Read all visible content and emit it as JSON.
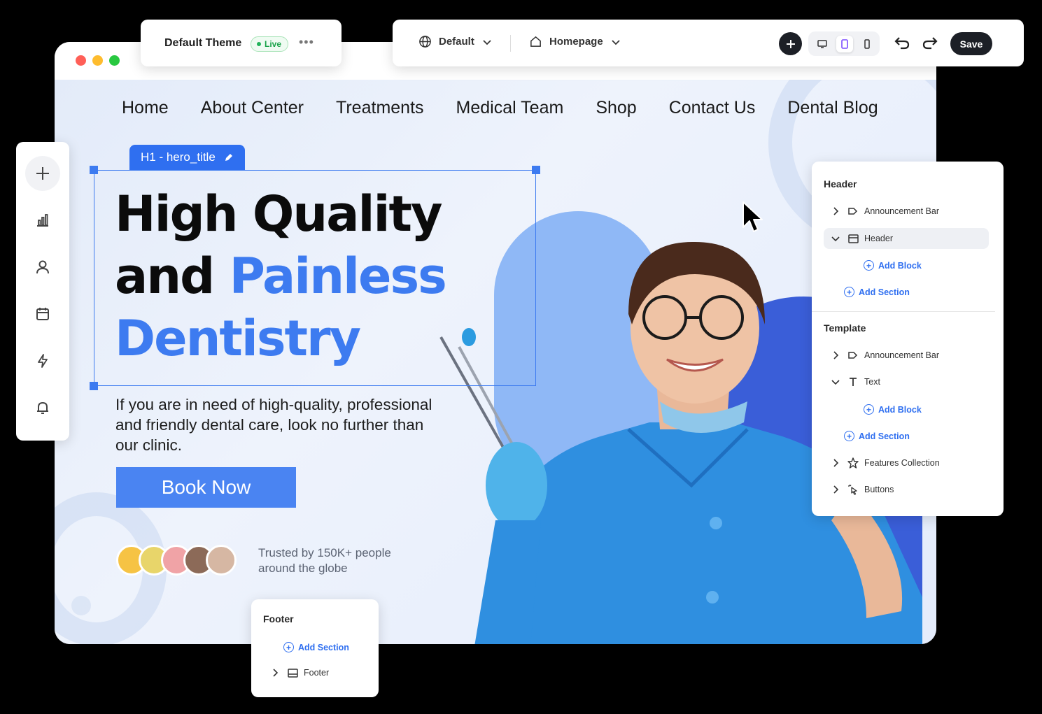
{
  "theme": {
    "name": "Default Theme",
    "status": "Live",
    "more": "•••"
  },
  "toolbar": {
    "locale_label": "Default",
    "page_label": "Homepage",
    "save_label": "Save"
  },
  "site": {
    "nav": [
      "Home",
      "About Center",
      "Treatments",
      "Medical Team",
      "Shop",
      "Contact Us",
      "Dental Blog"
    ],
    "selection_tag": "H1 - hero_title",
    "hero": {
      "line1": "High Quality",
      "line2_a": "and ",
      "line2_b": "Painless",
      "line3": "Dentistry",
      "description": "If you are in need of high-quality, professional and friendly dental care, look no further than our clinic.",
      "cta": "Book Now",
      "trust_line1": "Trusted by 150K+ people",
      "trust_line2": "around the globe"
    },
    "colors": {
      "accent": "#3d7bf0",
      "button": "#4a84f2",
      "scrub": "#2f8fe0"
    }
  },
  "tree": {
    "header_heading": "Header",
    "header_items": [
      {
        "label": "Announcement Bar",
        "icon": "announcement-icon",
        "expanded": false
      },
      {
        "label": "Header",
        "icon": "layout-icon",
        "expanded": true
      }
    ],
    "add_block": "Add Block",
    "add_section": "Add Section",
    "template_heading": "Template",
    "template_items": [
      {
        "label": "Announcement Bar",
        "icon": "announcement-icon",
        "expanded": false
      },
      {
        "label": "Text",
        "icon": "text-icon",
        "expanded": true
      },
      {
        "label": "Features Collection",
        "icon": "star-icon",
        "expanded": false
      },
      {
        "label": "Buttons",
        "icon": "cursor-click-icon",
        "expanded": false
      }
    ]
  },
  "footer_panel": {
    "heading": "Footer",
    "add_section": "Add Section",
    "item": "Footer"
  },
  "sidebar_icons": [
    "plus-icon",
    "chart-icon",
    "user-icon",
    "calendar-icon",
    "bolt-icon",
    "bell-icon"
  ]
}
